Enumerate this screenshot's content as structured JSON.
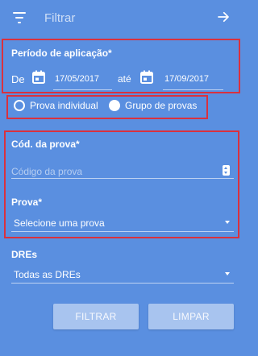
{
  "header": {
    "title": "Filtrar"
  },
  "periodo": {
    "label": "Período de aplicação*",
    "de_label": "De",
    "ate_label": "até",
    "start_date": "17/05/2017",
    "end_date": "17/09/2017"
  },
  "tipo": {
    "options": [
      "Prova individual",
      "Grupo de provas"
    ],
    "selected": "Grupo de provas"
  },
  "codigo": {
    "label": "Cód. da prova*",
    "placeholder": "Código da prova"
  },
  "prova": {
    "label": "Prova*",
    "value": "Selecione uma prova"
  },
  "dres": {
    "label": "DREs",
    "value": "Todas as DREs"
  },
  "buttons": {
    "filter": "FILTRAR",
    "clear": "LIMPAR"
  },
  "colors": {
    "background": "#5a8fe0",
    "highlight": "#d9313e",
    "button": "#a8c4ef"
  }
}
